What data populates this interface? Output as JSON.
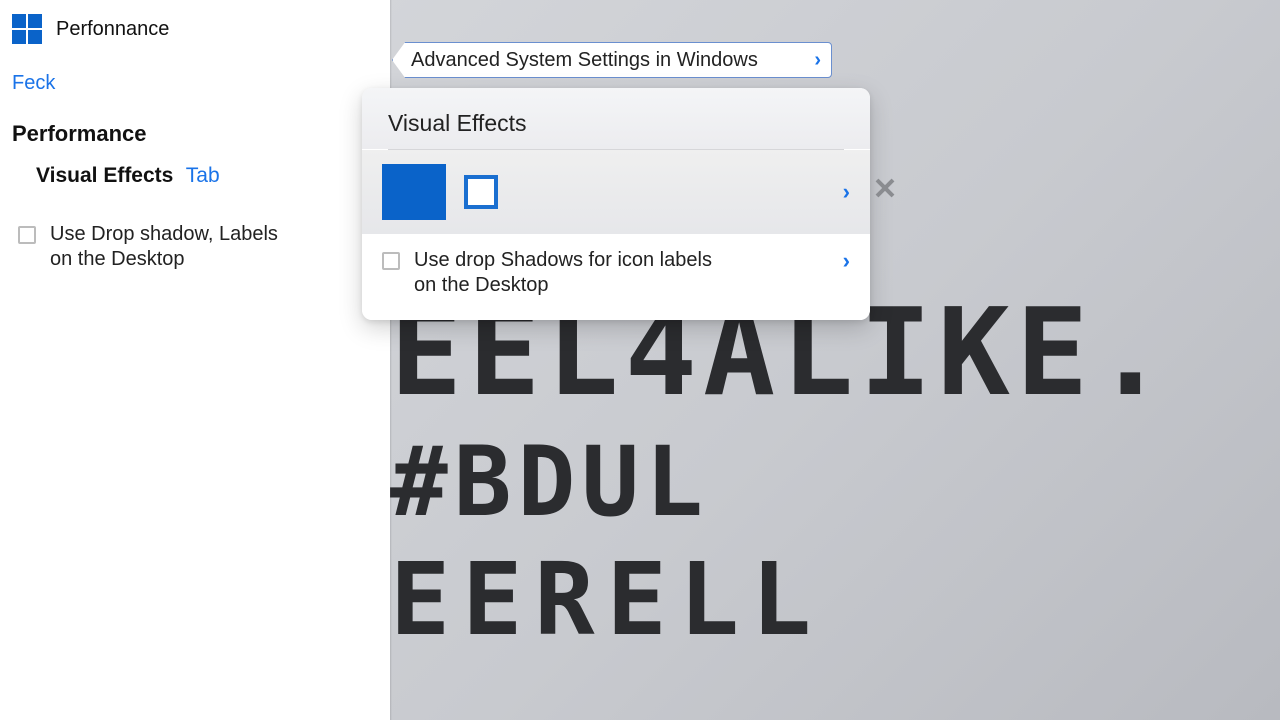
{
  "header": {
    "app_title": "Perfonnance"
  },
  "sidebar": {
    "feck": "Feck",
    "performance_label": "Performance",
    "visual_effects_label": "Visual Effects",
    "tab_tag": "Tab",
    "option1": "Use Drop shadow, Labels on the Desktop"
  },
  "breadcrumb": {
    "text": "Advanced System Settings in Windows"
  },
  "card": {
    "title": "Visual Effects",
    "option_desktop_shadow": "Use drop Shadows for icon labels on the Desktop"
  },
  "bg_text": {
    "line1": "EEL4ALIKE.",
    "line2": "#BDUL",
    "line3": "EERELL"
  }
}
